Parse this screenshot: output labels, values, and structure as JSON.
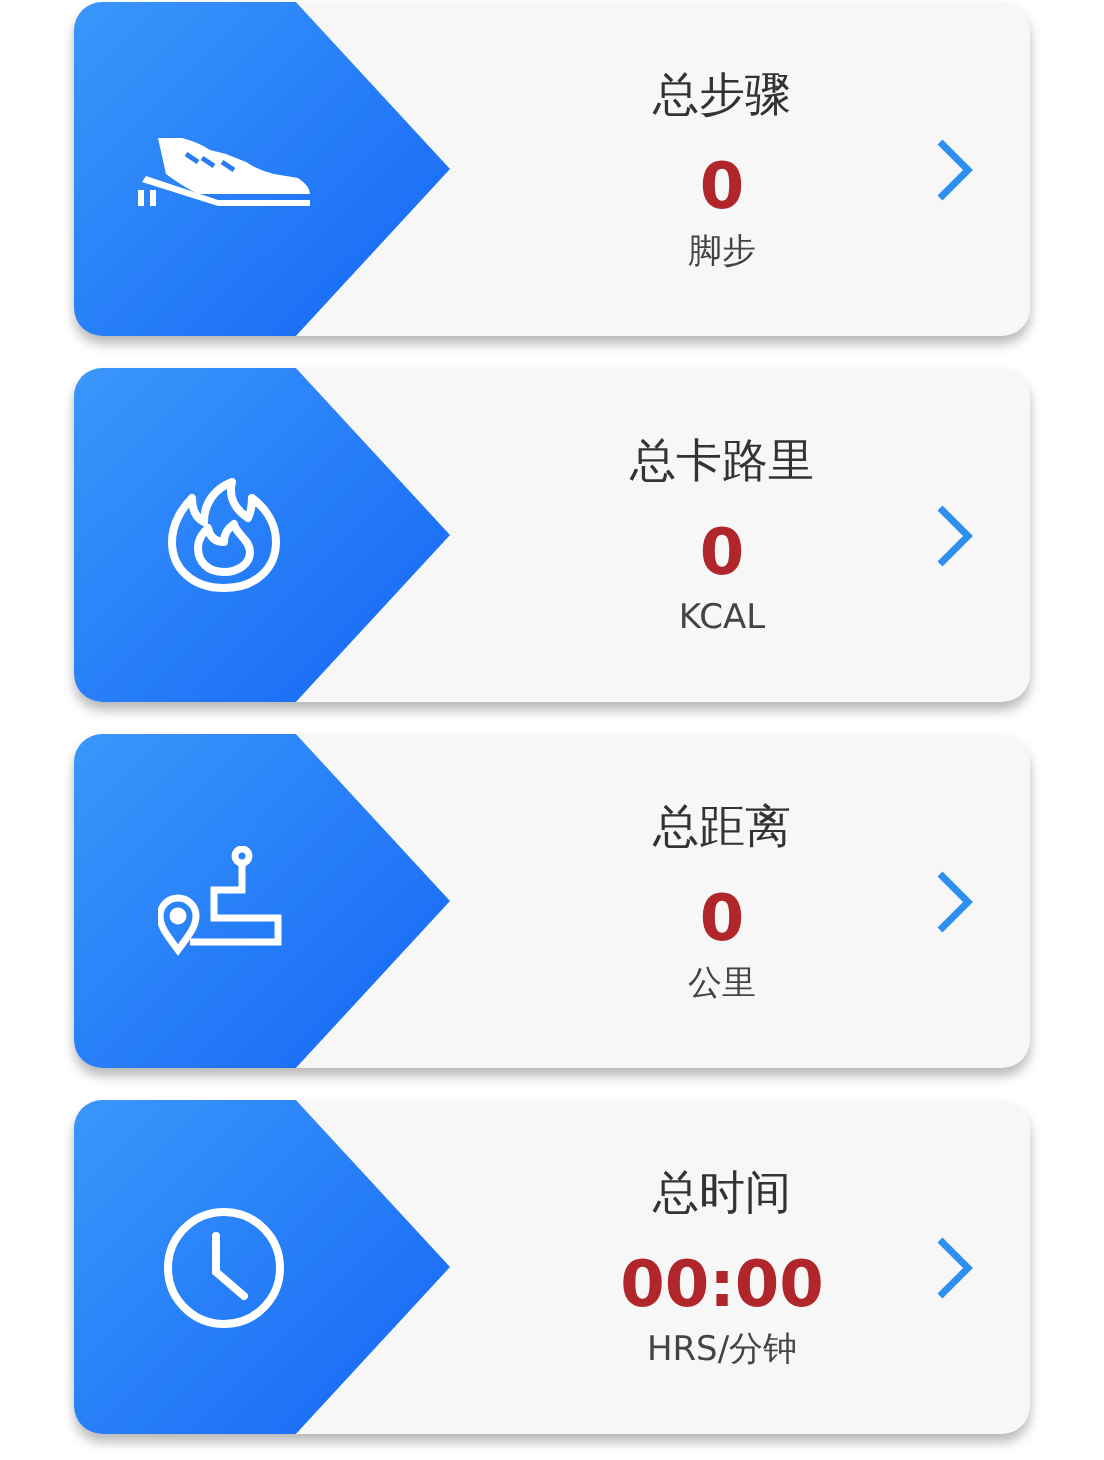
{
  "cards": [
    {
      "kind": "shoe",
      "title": "总步骤",
      "value": "0",
      "unit": "脚步"
    },
    {
      "kind": "flame",
      "title": "总卡路里",
      "value": "0",
      "unit": "KCAL"
    },
    {
      "kind": "route",
      "title": "总距离",
      "value": "0",
      "unit": "公里"
    },
    {
      "kind": "clock",
      "title": "总时间",
      "value": "00:00",
      "unit": "HRS/分钟"
    }
  ]
}
